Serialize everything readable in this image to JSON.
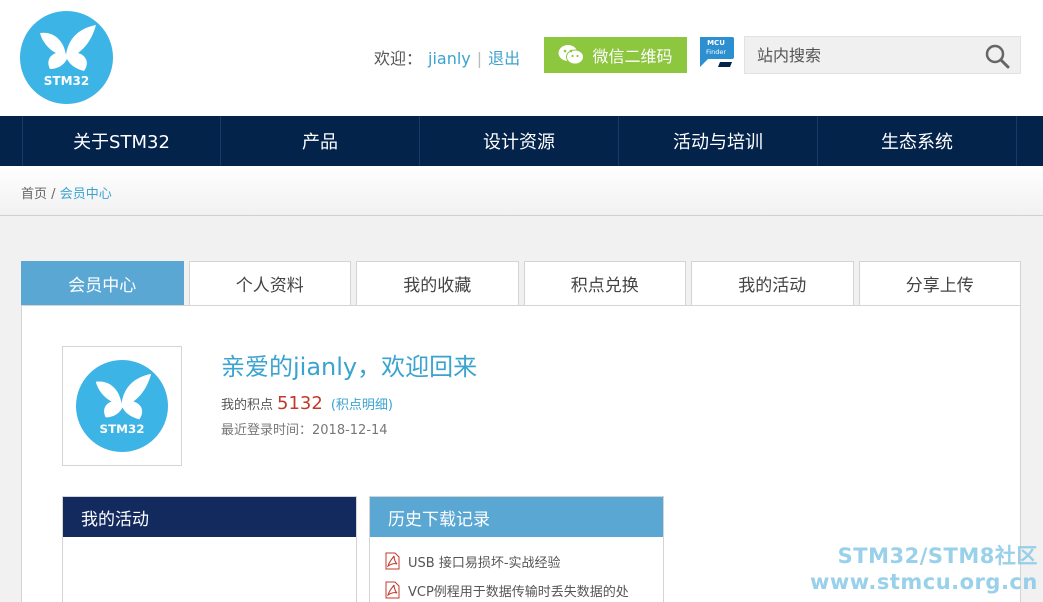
{
  "header": {
    "logo_text": "STM32",
    "welcome_label": "欢迎：",
    "username": "jianly",
    "separator": "|",
    "logout": "退出",
    "wechat_button": "微信二维码",
    "mcu_badge_line1": "MCU",
    "mcu_badge_line2": "Finder",
    "search_placeholder": "站内搜索"
  },
  "nav": {
    "items": [
      {
        "label": "关于STM32"
      },
      {
        "label": "产品"
      },
      {
        "label": "设计资源"
      },
      {
        "label": "活动与培训"
      },
      {
        "label": "生态系统"
      }
    ]
  },
  "breadcrumb": {
    "home": "首页",
    "separator": "/",
    "current": "会员中心"
  },
  "tabs": [
    {
      "label": "会员中心",
      "active": true
    },
    {
      "label": "个人资料"
    },
    {
      "label": "我的收藏"
    },
    {
      "label": "积点兑换"
    },
    {
      "label": "我的活动"
    },
    {
      "label": "分享上传"
    }
  ],
  "profile": {
    "avatar_text": "STM32",
    "greeting": "亲爱的jianly，欢迎回来",
    "points_label": "我的积点",
    "points_value": "5132",
    "points_detail": "(积点明细)",
    "last_login": "最近登录时间：2018-12-14"
  },
  "activity_box": {
    "title": "我的活动"
  },
  "downloads_box": {
    "title": "历史下载记录",
    "items": [
      {
        "title": "USB 接口易损坏-实战经验"
      },
      {
        "title": "VCP例程用于数据传输时丢失数据的处"
      }
    ]
  },
  "watermark": {
    "line1": "STM32/STM8社区",
    "line2": "www.stmcu.org.cn"
  },
  "colors": {
    "nav_bg": "#03234b",
    "accent_blue": "#3aa3d0",
    "tab_active": "#5aa7d4",
    "wechat_green": "#8dc63f",
    "points_red": "#c0392b"
  }
}
